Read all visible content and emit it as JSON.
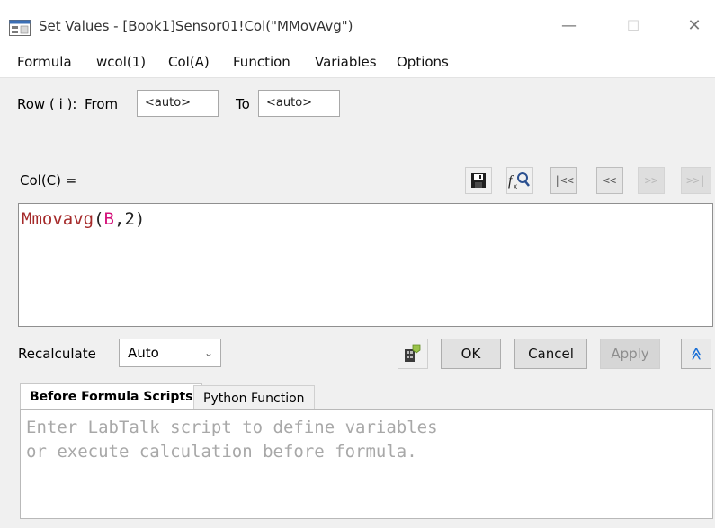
{
  "window": {
    "title": "Set Values - [Book1]Sensor01!Col(\"MMovAvg\")",
    "minimize_symbol": "—",
    "maximize_symbol": "☐",
    "close_symbol": "✕"
  },
  "menu": [
    "Formula",
    "wcol(1)",
    "Col(A)",
    "Function",
    "Variables",
    "Options"
  ],
  "row_range": {
    "label": "Row ( i ):",
    "from_label": "From",
    "from_value": "<auto>",
    "to_label": "To",
    "to_value": "<auto>"
  },
  "formula": {
    "label": "Col(C) =",
    "func": "Mmovavg",
    "open": "(",
    "arg1": "B",
    "comma": ",",
    "arg2": "2",
    "close": ")"
  },
  "toolbar": {
    "first": "|<<",
    "prev": "<<",
    "next": ">>",
    "last": ">>|"
  },
  "recalculate": {
    "label": "Recalculate",
    "value": "Auto"
  },
  "buttons": {
    "ok": "OK",
    "cancel": "Cancel",
    "apply": "Apply",
    "collapse": "≫"
  },
  "tabs": [
    "Before Formula Scripts",
    "Python Function"
  ],
  "script_placeholder": {
    "line1": "Enter LabTalk script to define variables",
    "line2": "or execute calculation before formula."
  },
  "colors": {
    "function": "#a52a2a",
    "paren": "#d4117a",
    "column_ref": "#d4117a",
    "number": "#222222",
    "collapse_icon": "#1a6fd6"
  }
}
